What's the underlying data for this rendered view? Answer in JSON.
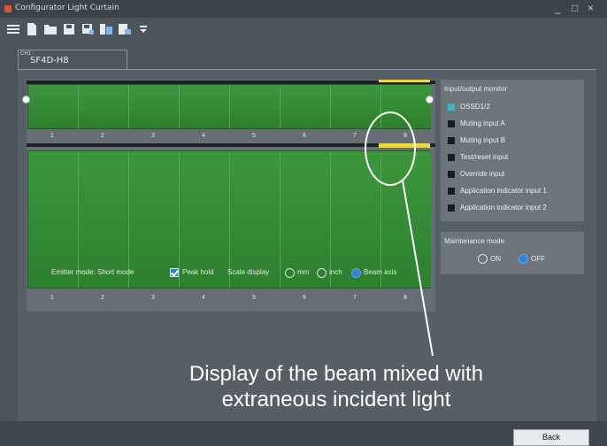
{
  "window": {
    "title": "Configurator Light Curtain",
    "controls": [
      "_",
      "□",
      "×"
    ]
  },
  "toolbar": {
    "buttons": [
      "menu-icon",
      "new-file-icon",
      "open-folder-icon",
      "save-icon",
      "save-as-icon",
      "compare-icon",
      "export-icon",
      "dropdown-icon"
    ]
  },
  "tab": {
    "channel": "CH1",
    "model": "SF4D-H8"
  },
  "beams": {
    "numbers": [
      "1",
      "2",
      "3",
      "4",
      "5",
      "6",
      "7",
      "8"
    ],
    "colors": {
      "beam": "#2b7d2d",
      "extraneous": "#e8d849"
    }
  },
  "options": {
    "emitter_mode": "Emitter mode: Short mode",
    "peak_hold": "Peak hold",
    "scale_display": "Scale display",
    "mm": "mm",
    "inch": "inch",
    "beam_axis": "Beam axis"
  },
  "io_monitor": {
    "title": "Input/output monitor",
    "items": [
      {
        "label": "OSSD1/2",
        "lit": true
      },
      {
        "label": "Muting input A",
        "lit": false
      },
      {
        "label": "Muting input B",
        "lit": false
      },
      {
        "label": "Test/reset input",
        "lit": false
      },
      {
        "label": "Override input",
        "lit": false
      },
      {
        "label": "Application indicator input 1",
        "lit": false
      },
      {
        "label": "Application indicator input 2",
        "lit": false
      }
    ]
  },
  "maintenance": {
    "title": "Maintenance mode",
    "on": "ON",
    "off": "OFF"
  },
  "annotation": {
    "line1": "Display of the beam mixed with",
    "line2": "extraneous incident light"
  },
  "footer": {
    "back": "Back"
  }
}
